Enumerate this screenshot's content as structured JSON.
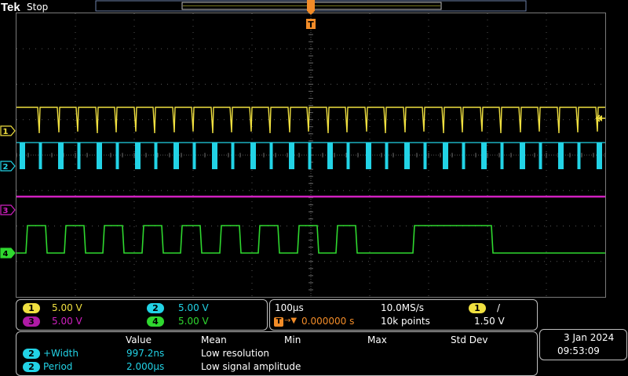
{
  "header": {
    "brand": "Tek",
    "status": "Stop"
  },
  "trigger_marker": "T",
  "channels": [
    {
      "id": "1",
      "color": "#f0e040",
      "scale": "5.00 V"
    },
    {
      "id": "2",
      "color": "#22d3e6",
      "scale": "5.00 V"
    },
    {
      "id": "3",
      "color": "#d020c0",
      "scale": "5.00 V"
    },
    {
      "id": "4",
      "color": "#2fd82f",
      "scale": "5.00 V"
    }
  ],
  "horizontal": {
    "time_div": "100µs",
    "sample_rate": "10.0MS/s",
    "delay": "0.000000 s",
    "record_length": "10k points"
  },
  "trigger": {
    "source": "1",
    "slope_glyph": "/",
    "level": "1.50 V",
    "accent": "#f28c28"
  },
  "measurements": {
    "headers": [
      "Value",
      "Mean",
      "Min",
      "Max",
      "Std Dev"
    ],
    "rows": [
      {
        "source": "2",
        "name": "+Width",
        "value": "997.2ns",
        "mean": "Low resolution"
      },
      {
        "source": "2",
        "name": "Period",
        "value": "2.000µs",
        "mean": "Low signal amplitude"
      }
    ]
  },
  "datetime": {
    "date": "3 Jan  2024",
    "time": "09:53:09"
  }
}
